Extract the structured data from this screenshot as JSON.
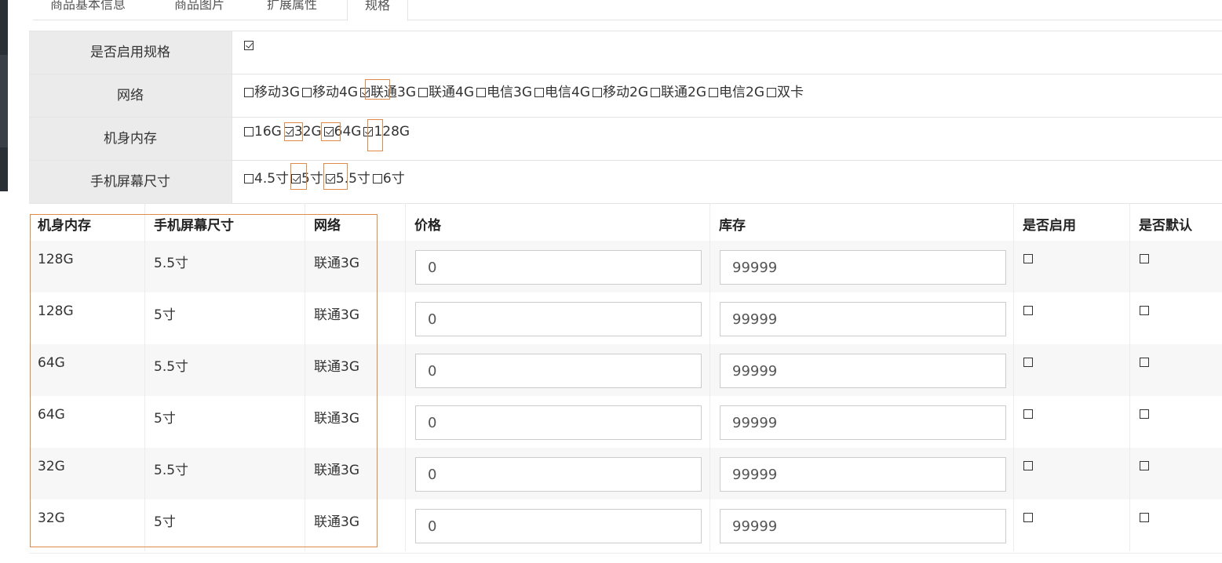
{
  "tabs": [
    "商品基本信息",
    "商品图片",
    "扩展属性",
    "规格"
  ],
  "spec": {
    "enable": {
      "label": "是否启用规格",
      "checked": true
    },
    "rows": [
      {
        "label": "网络",
        "options": [
          {
            "text": "移动3G",
            "checked": false
          },
          {
            "text": "移动4G",
            "checked": false
          },
          {
            "text": "联通3G",
            "checked": true
          },
          {
            "text": "联通4G",
            "checked": false
          },
          {
            "text": "电信3G",
            "checked": false
          },
          {
            "text": "电信4G",
            "checked": false
          },
          {
            "text": "移动2G",
            "checked": false
          },
          {
            "text": "联通2G",
            "checked": false
          },
          {
            "text": "电信2G",
            "checked": false
          },
          {
            "text": "双卡",
            "checked": false
          }
        ]
      },
      {
        "label": "机身内存",
        "options": [
          {
            "text": "16G",
            "checked": false
          },
          {
            "text": "32G",
            "checked": true
          },
          {
            "text": "64G",
            "checked": true
          },
          {
            "text": "128G",
            "checked": true
          }
        ]
      },
      {
        "label": "手机屏幕尺寸",
        "options": [
          {
            "text": "4.5寸",
            "checked": false
          },
          {
            "text": "5寸",
            "checked": true
          },
          {
            "text": "5.5寸",
            "checked": true
          },
          {
            "text": "6寸",
            "checked": false
          }
        ]
      }
    ]
  },
  "sku_table": {
    "headers": [
      "机身内存",
      "手机屏幕尺寸",
      "网络",
      "价格",
      "库存",
      "是否启用",
      "是否默认"
    ],
    "rows": [
      {
        "memory": "128G",
        "screen": "5.5寸",
        "network": "联通3G",
        "price": "0",
        "stock": "99999",
        "enabled": false,
        "default": false
      },
      {
        "memory": "128G",
        "screen": "5寸",
        "network": "联通3G",
        "price": "0",
        "stock": "99999",
        "enabled": false,
        "default": false
      },
      {
        "memory": "64G",
        "screen": "5.5寸",
        "network": "联通3G",
        "price": "0",
        "stock": "99999",
        "enabled": false,
        "default": false
      },
      {
        "memory": "64G",
        "screen": "5寸",
        "network": "联通3G",
        "price": "0",
        "stock": "99999",
        "enabled": false,
        "default": false
      },
      {
        "memory": "32G",
        "screen": "5.5寸",
        "network": "联通3G",
        "price": "0",
        "stock": "99999",
        "enabled": false,
        "default": false
      },
      {
        "memory": "32G",
        "screen": "5寸",
        "network": "联通3G",
        "price": "0",
        "stock": "99999",
        "enabled": false,
        "default": false
      }
    ]
  },
  "colors": {
    "highlight": "#e08a4a",
    "label_bg": "#ebebeb",
    "stripe_bg": "#f7f7f7"
  }
}
